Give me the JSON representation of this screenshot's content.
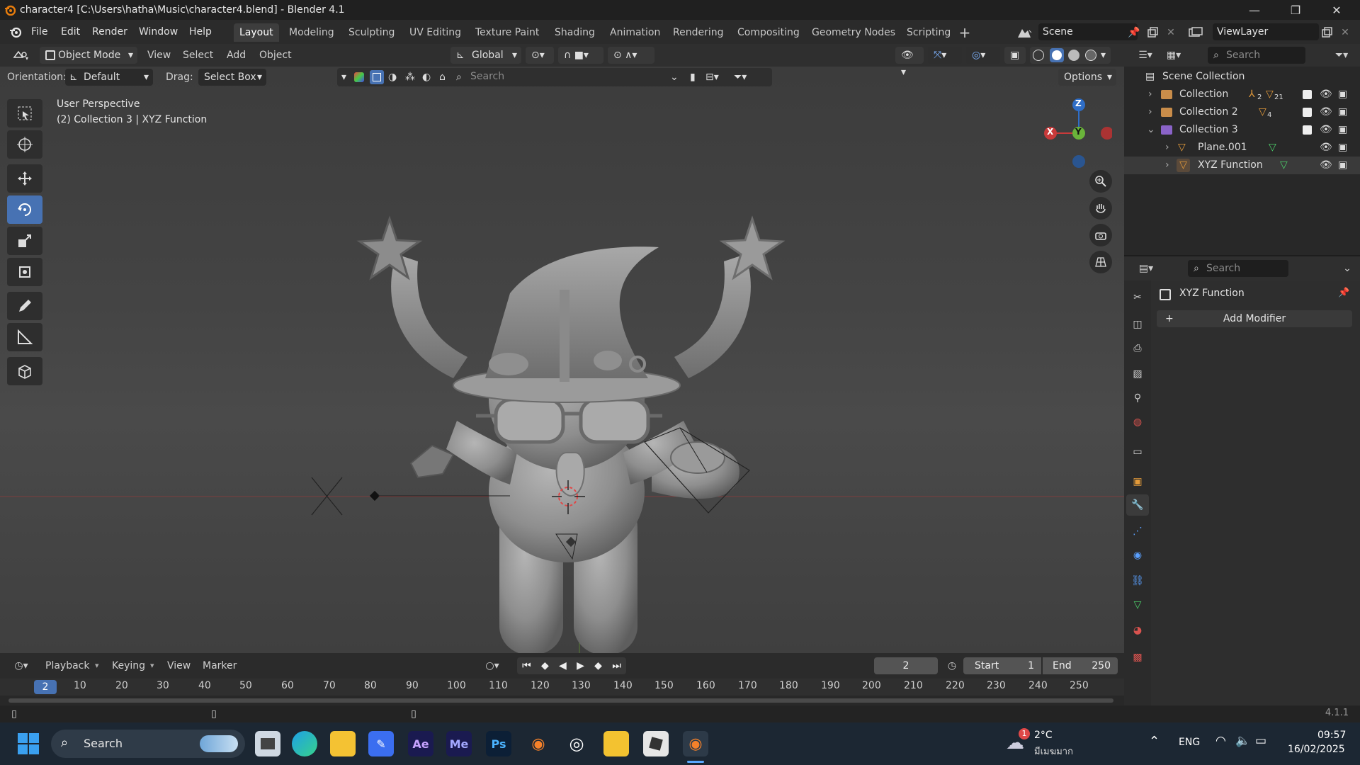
{
  "window": {
    "title": "character4 [C:\\Users\\hatha\\Music\\character4.blend] - Blender 4.1",
    "minimize": "—",
    "maximize": "❐",
    "close": "✕"
  },
  "menus": [
    "File",
    "Edit",
    "Render",
    "Window",
    "Help"
  ],
  "workspaces": [
    "Layout",
    "Modeling",
    "Sculpting",
    "UV Editing",
    "Texture Paint",
    "Shading",
    "Animation",
    "Rendering",
    "Compositing",
    "Geometry Nodes",
    "Scripting"
  ],
  "active_workspace": "Layout",
  "scene": "Scene",
  "view_layer": "ViewLayer",
  "viewport_header": {
    "mode": "Object Mode",
    "menus": [
      "View",
      "Select",
      "Add",
      "Object"
    ],
    "transform_orientation": "Global",
    "orientation_label": "Orientation:",
    "orientation_value": "Default",
    "drag_label": "Drag:",
    "drag_value": "Select Box",
    "search_placeholder": "Search",
    "options": "Options"
  },
  "viewport_overlay": {
    "line1": "User Perspective",
    "line2": "(2) Collection 3 | XYZ Function"
  },
  "gizmo": {
    "x": "X",
    "y": "Y",
    "z": "Z"
  },
  "outliner": {
    "search_placeholder": "Search",
    "root": "Scene Collection",
    "items": [
      {
        "name": "Collection",
        "badge1": "2",
        "badge2": "21"
      },
      {
        "name": "Collection 2",
        "badge1": "4"
      },
      {
        "name": "Collection 3"
      },
      {
        "name": "Plane.001"
      },
      {
        "name": "XYZ Function"
      }
    ]
  },
  "properties": {
    "search_placeholder": "Search",
    "object_name": "XYZ Function",
    "add_modifier": "Add Modifier"
  },
  "timeline": {
    "menus": [
      "Playback",
      "Keying",
      "View",
      "Marker"
    ],
    "current_frame": "2",
    "start_label": "Start",
    "start": "1",
    "end_label": "End",
    "end": "250",
    "ticks": [
      "10",
      "20",
      "30",
      "40",
      "50",
      "60",
      "70",
      "80",
      "90",
      "100",
      "110",
      "120",
      "130",
      "140",
      "150",
      "160",
      "170",
      "180",
      "190",
      "200",
      "210",
      "220",
      "230",
      "240",
      "250"
    ]
  },
  "status": {
    "version": "4.1.1"
  },
  "taskbar": {
    "search": "Search",
    "weather_temp": "2°C",
    "weather_desc": "มีเมฆมาก",
    "weather_badge": "1",
    "language": "ENG",
    "time": "09:57",
    "date": "16/02/2025",
    "apps": [
      "Ae",
      "Me",
      "Ps"
    ]
  }
}
